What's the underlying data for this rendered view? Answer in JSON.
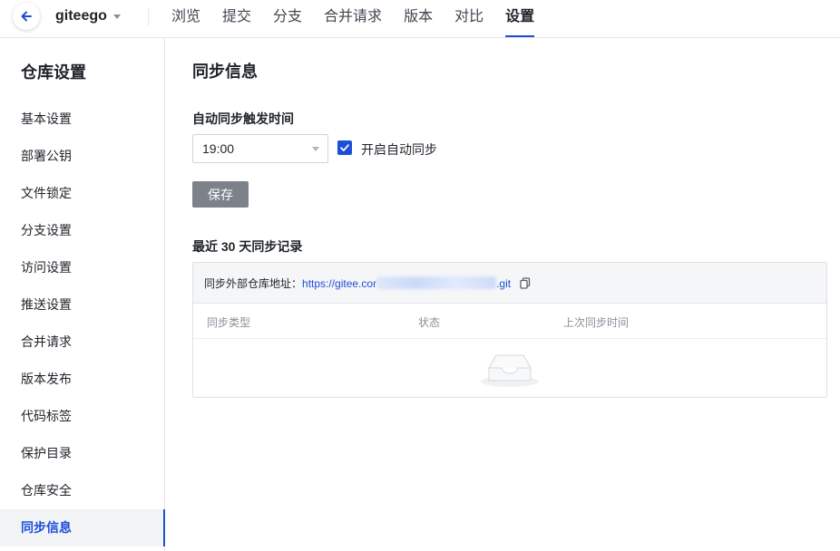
{
  "header": {
    "repo_name": "giteego",
    "tabs": [
      {
        "label": "浏览",
        "active": false
      },
      {
        "label": "提交",
        "active": false
      },
      {
        "label": "分支",
        "active": false
      },
      {
        "label": "合并请求",
        "active": false
      },
      {
        "label": "版本",
        "active": false
      },
      {
        "label": "对比",
        "active": false
      },
      {
        "label": "设置",
        "active": true
      }
    ]
  },
  "sidebar": {
    "title": "仓库设置",
    "items": [
      {
        "label": "基本设置"
      },
      {
        "label": "部署公钥"
      },
      {
        "label": "文件锁定"
      },
      {
        "label": "分支设置"
      },
      {
        "label": "访问设置"
      },
      {
        "label": "推送设置"
      },
      {
        "label": "合并请求"
      },
      {
        "label": "版本发布"
      },
      {
        "label": "代码标签"
      },
      {
        "label": "保护目录"
      },
      {
        "label": "仓库安全"
      },
      {
        "label": "同步信息",
        "active": true
      }
    ]
  },
  "main": {
    "title": "同步信息",
    "trigger_label": "自动同步触发时间",
    "time_value": "19:00",
    "auto_sync_label": "开启自动同步",
    "auto_sync_checked": true,
    "save_label": "保存",
    "records_title": "最近 30 天同步记录",
    "external_repo_label": "同步外部仓库地址：",
    "external_repo_url_prefix": "https://gitee.cor",
    "external_repo_url_suffix": ".git",
    "columns": [
      "同步类型",
      "状态",
      "上次同步时间"
    ]
  },
  "colors": {
    "accent": "#1d4ed8",
    "save_button": "#7d828a",
    "border": "#e5e6eb"
  }
}
